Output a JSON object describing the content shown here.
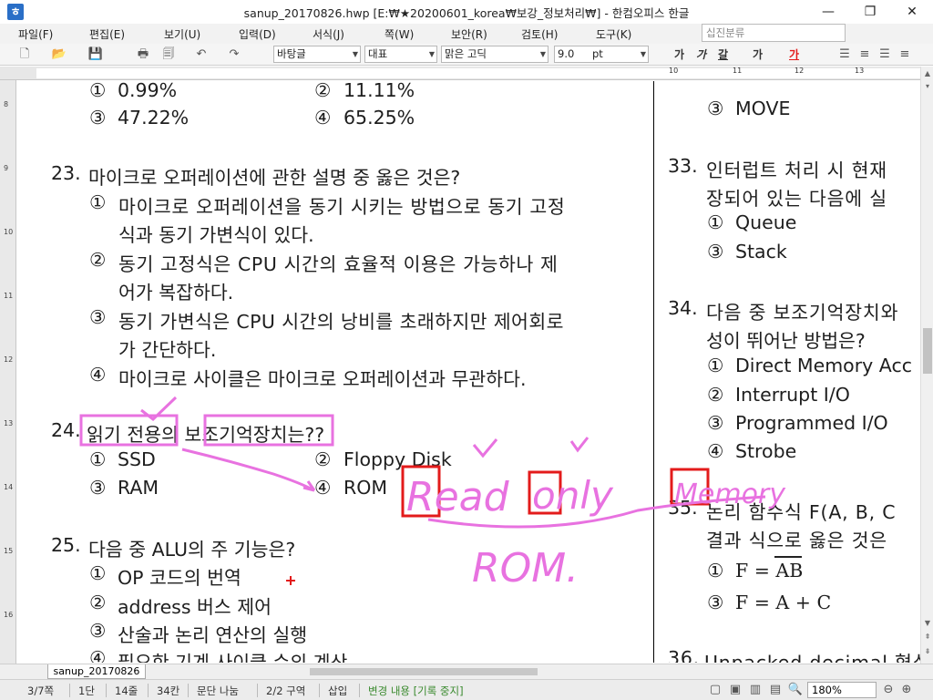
{
  "window": {
    "title": "sanup_20170826.hwp [E:₩★20200601_korea₩보강_정보처리₩] - 한컴오피스 한글",
    "app_icon": "hwp-app-icon",
    "controls": {
      "minimize": "—",
      "maximize": "❐",
      "close": "✕"
    }
  },
  "menu": {
    "items": [
      "파일(F)",
      "편집(E)",
      "보기(U)",
      "입력(D)",
      "서식(J)",
      "쪽(W)",
      "보안(R)",
      "검토(H)",
      "도구(K)"
    ],
    "search_placeholder": "십진분류"
  },
  "toolbar": {
    "style_combo": "바탕글",
    "lang_combo": "대표",
    "font_combo": "맑은 고딕",
    "size_combo": "9.0",
    "size_unit": "pt",
    "format_buttons": [
      "가",
      "가",
      "갈",
      "가",
      "가"
    ],
    "align_icons": [
      "align-justify-icon",
      "align-left-icon",
      "align-center-icon",
      "align-right-icon"
    ]
  },
  "ruler": {
    "labels": [
      "10",
      "11",
      "12",
      "13"
    ],
    "vertical_labels": [
      "8",
      "9",
      "10",
      "11",
      "12",
      "13",
      "14",
      "15",
      "16"
    ]
  },
  "left_column": {
    "prev_options": [
      {
        "marker": "①",
        "text": "0.99%"
      },
      {
        "marker": "②",
        "text": "11.11%"
      },
      {
        "marker": "③",
        "text": "47.22%"
      },
      {
        "marker": "④",
        "text": "65.25%"
      }
    ],
    "q23": {
      "number": "23.",
      "question": "마이크로 오퍼레이션에 관한 설명 중 옳은 것은?",
      "options": [
        {
          "marker": "①",
          "line1": "마이크로 오퍼레이션을 동기 시키는 방법으로 동기 고정",
          "line2": "식과 동기 가변식이 있다."
        },
        {
          "marker": "②",
          "line1": "동기 고정식은 CPU 시간의 효율적 이용은 가능하나 제",
          "line2": "어가 복잡하다."
        },
        {
          "marker": "③",
          "line1": "동기 가변식은 CPU 시간의 낭비를 초래하지만 제어회로",
          "line2": "가 간단하다."
        },
        {
          "marker": "④",
          "line1": "마이크로 사이클은 마이크로 오퍼레이션과 무관하다."
        }
      ]
    },
    "q24": {
      "number": "24.",
      "question_part1": "읽기 전용",
      "question_part2": "의 ",
      "question_part3": "보조기억장치는",
      "question_part4": "??",
      "options": [
        {
          "marker": "①",
          "text": "SSD"
        },
        {
          "marker": "②",
          "text": "Floppy Disk"
        },
        {
          "marker": "③",
          "text": "RAM"
        },
        {
          "marker": "④",
          "text": "ROM"
        }
      ]
    },
    "q25": {
      "number": "25.",
      "question": "다음 중 ALU의 주 기능은?",
      "options": [
        {
          "marker": "①",
          "text": "OP 코드의 번역"
        },
        {
          "marker": "②",
          "text": "address 버스 제어"
        },
        {
          "marker": "③",
          "text": "산술과 논리 연산의 실행"
        },
        {
          "marker": "④",
          "text": "필요한 기계 사이클 수의 계산"
        }
      ]
    }
  },
  "right_column": {
    "prev_options": [
      {
        "marker": "③",
        "text": "MOVE"
      }
    ],
    "q33": {
      "number": "33.",
      "line1": "인터럽트 처리 시 현재",
      "line2": "장되어 있는 다음에 실",
      "options": [
        {
          "marker": "①",
          "text": "Queue"
        },
        {
          "marker": "③",
          "text": "Stack"
        }
      ]
    },
    "q34": {
      "number": "34.",
      "line1": "다음 중 보조기억장치와",
      "line2": "성이 뛰어난 방법은?",
      "options": [
        {
          "marker": "①",
          "text": "Direct Memory Acc"
        },
        {
          "marker": "②",
          "text": "Interrupt I/O"
        },
        {
          "marker": "③",
          "text": "Programmed I/O"
        },
        {
          "marker": "④",
          "text": "Strobe"
        }
      ]
    },
    "q35": {
      "number": "35.",
      "line1": "논리 함수식 F(A, B, C",
      "line2": "결과 식으로 옳은 것은",
      "options": [
        {
          "marker": "①",
          "text": "F = AB"
        },
        {
          "marker": "③",
          "text": "F = A + C"
        }
      ]
    },
    "q36": {
      "number": "36.",
      "line1": "Unpacked decimal 형식"
    }
  },
  "annotations": {
    "ink_words": [
      "Read",
      "only",
      "Memory",
      "ROM."
    ]
  },
  "tabbar": {
    "doc_tab": "sanup_20170826"
  },
  "status": {
    "page": "3/7쪽",
    "column": "1단",
    "line": "14줄",
    "char": "34칸",
    "section": "문단 나눔",
    "region": "2/2 구역",
    "mode": "삽입",
    "track": "변경 내용 [기록 중지]",
    "zoom": "180%"
  },
  "colors": {
    "ink": "#e872e0",
    "box_red": "#e31b1b",
    "accent_blue": "#2a6fc7",
    "track_green": "#3a8a2e"
  }
}
